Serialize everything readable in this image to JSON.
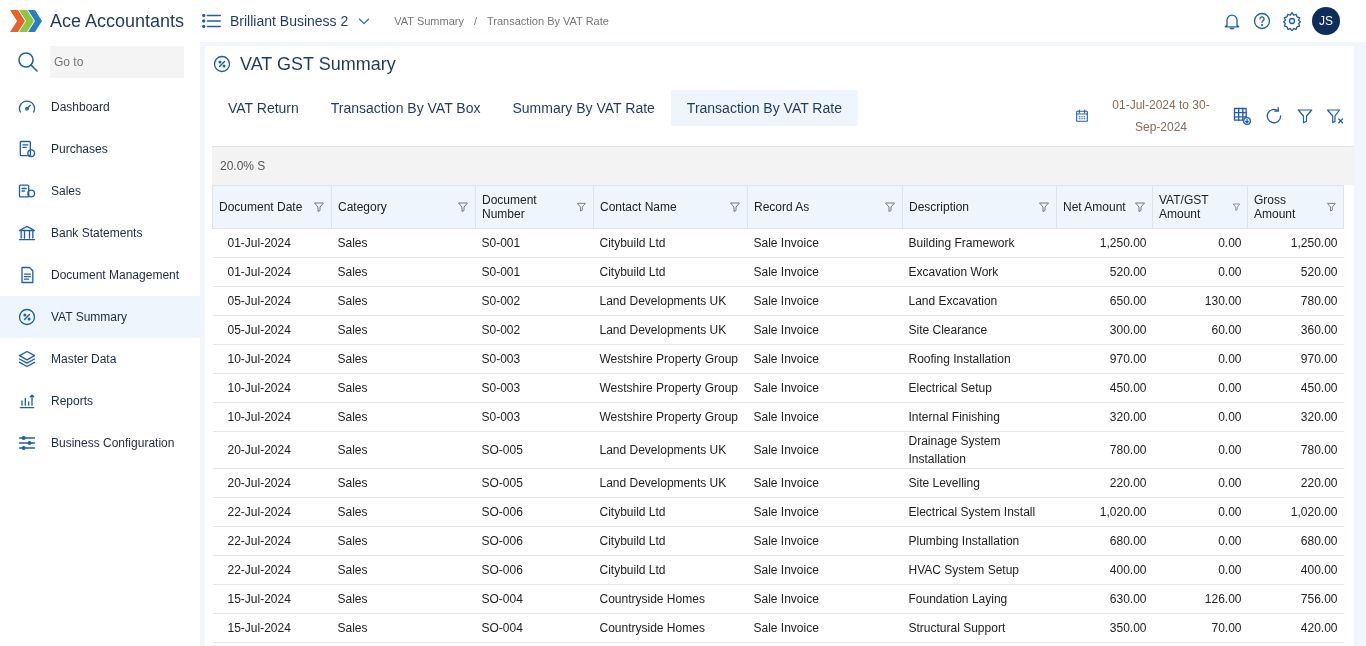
{
  "app": {
    "name": "Ace Accountants"
  },
  "top_bar": {
    "business": "Brilliant Business 2",
    "breadcrumb": [
      "VAT Summary",
      "Transaction By VAT Rate"
    ],
    "breadcrumb_separator": "/",
    "avatar": "JS"
  },
  "sidebar": {
    "search": {
      "placeholder": "Go to"
    },
    "items": [
      {
        "label": "Dashboard",
        "selected": false
      },
      {
        "label": "Purchases",
        "selected": false
      },
      {
        "label": "Sales",
        "selected": false
      },
      {
        "label": "Bank Statements",
        "selected": false
      },
      {
        "label": "Document Management",
        "selected": false
      },
      {
        "label": "VAT Summary",
        "selected": true
      },
      {
        "label": "Master Data",
        "selected": false
      },
      {
        "label": "Reports",
        "selected": false
      },
      {
        "label": "Business Configuration",
        "selected": false
      }
    ]
  },
  "page": {
    "title": "VAT GST Summary",
    "tabs": [
      {
        "label": "VAT Return",
        "selected": false
      },
      {
        "label": "Transaction By VAT Box",
        "selected": false
      },
      {
        "label": "Summary By VAT Rate",
        "selected": false
      },
      {
        "label": "Transaction By VAT Rate",
        "selected": true
      }
    ],
    "date_range": "01-Jul-2024 to 30-Sep-2024",
    "group": "20.0% S",
    "table": {
      "columns": [
        "Document Date",
        "Category",
        "Document Number",
        "Contact Name",
        "Record As",
        "Description",
        "Net Amount",
        "VAT/GST Amount",
        "Gross Amount"
      ],
      "rows": [
        [
          "01-Jul-2024",
          "Sales",
          "S0-001",
          "Citybuild Ltd",
          "Sale Invoice",
          "Building Framework",
          "1,250.00",
          "0.00",
          "1,250.00"
        ],
        [
          "01-Jul-2024",
          "Sales",
          "S0-001",
          "Citybuild Ltd",
          "Sale Invoice",
          "Excavation Work",
          "520.00",
          "0.00",
          "520.00"
        ],
        [
          "05-Jul-2024",
          "Sales",
          "S0-002",
          "Land Developments UK",
          "Sale Invoice",
          "Land Excavation",
          "650.00",
          "130.00",
          "780.00"
        ],
        [
          "05-Jul-2024",
          "Sales",
          "S0-002",
          "Land Developments UK",
          "Sale Invoice",
          "Site Clearance",
          "300.00",
          "60.00",
          "360.00"
        ],
        [
          "10-Jul-2024",
          "Sales",
          "S0-003",
          "Westshire Property Group",
          "Sale Invoice",
          "Roofing Installation",
          "970.00",
          "0.00",
          "970.00"
        ],
        [
          "10-Jul-2024",
          "Sales",
          "S0-003",
          "Westshire Property Group",
          "Sale Invoice",
          "Electrical Setup",
          "450.00",
          "0.00",
          "450.00"
        ],
        [
          "10-Jul-2024",
          "Sales",
          "S0-003",
          "Westshire Property Group",
          "Sale Invoice",
          "Internal Finishing",
          "320.00",
          "0.00",
          "320.00"
        ],
        [
          "20-Jul-2024",
          "Sales",
          "SO-005",
          "Land Developments UK",
          "Sale Invoice",
          "Drainage System Installation",
          "780.00",
          "0.00",
          "780.00"
        ],
        [
          "20-Jul-2024",
          "Sales",
          "SO-005",
          "Land Developments UK",
          "Sale Invoice",
          "Site Levelling",
          "220.00",
          "0.00",
          "220.00"
        ],
        [
          "22-Jul-2024",
          "Sales",
          "SO-006",
          "Citybuild Ltd",
          "Sale Invoice",
          "Electrical System Install",
          "1,020.00",
          "0.00",
          "1,020.00"
        ],
        [
          "22-Jul-2024",
          "Sales",
          "SO-006",
          "Citybuild Ltd",
          "Sale Invoice",
          "Plumbing Installation",
          "680.00",
          "0.00",
          "680.00"
        ],
        [
          "22-Jul-2024",
          "Sales",
          "SO-006",
          "Citybuild Ltd",
          "Sale Invoice",
          "HVAC System Setup",
          "400.00",
          "0.00",
          "400.00"
        ],
        [
          "15-Jul-2024",
          "Sales",
          "SO-004",
          "Countryside Homes",
          "Sale Invoice",
          "Foundation Laying",
          "630.00",
          "126.00",
          "756.00"
        ],
        [
          "15-Jul-2024",
          "Sales",
          "SO-004",
          "Countryside Homes",
          "Sale Invoice",
          "Structural Support",
          "350.00",
          "70.00",
          "420.00"
        ]
      ]
    }
  }
}
